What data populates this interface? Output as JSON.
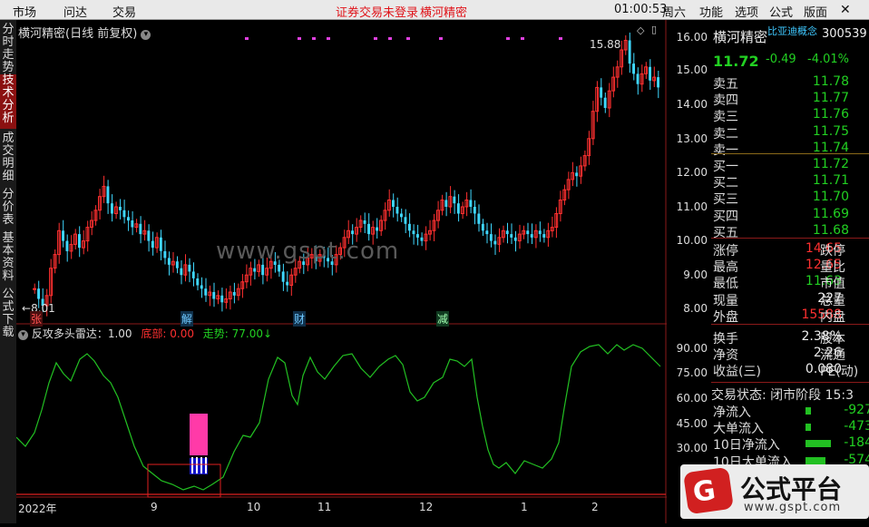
{
  "topbar": {
    "menu_left": [
      "市场",
      "问达",
      "交易"
    ],
    "notice": "证券交易未登录",
    "stock_name": "横河精密",
    "clock": "01:00:53",
    "weekday": "周六",
    "menu_right": [
      "功能",
      "选项",
      "公式",
      "版面"
    ]
  },
  "leftbar": [
    "分时走势",
    "技术分析",
    "成交明细",
    "分价表",
    "基本资料",
    "公式下载"
  ],
  "chart": {
    "title": "横河精密(日线 前复权)",
    "high_label": "15.88",
    "low_label": "8.01",
    "price_axis": [
      "16.00",
      "15.00",
      "14.00",
      "13.00",
      "12.00",
      "11.00",
      "10.00",
      "9.00",
      "8.00"
    ],
    "markers": [
      "张",
      "解",
      "财",
      "减"
    ],
    "indicator_name": "反攻多头雷达：1.00",
    "indicator_bottom": "底部: 0.00",
    "indicator_trend": "走势: 77.00",
    "indicator_axis": [
      "90.00",
      "75.00",
      "60.00",
      "45.00",
      "30.00"
    ],
    "x_axis": [
      "2022年",
      "9",
      "10",
      "11",
      "12",
      "1",
      "2"
    ],
    "watermark": "www.gspt.com",
    "logo_text": "公式平台",
    "logo_url": "www.gspt.com"
  },
  "quote": {
    "name": "横河精密",
    "code": "300539",
    "concept": "比亚迪概念",
    "price": "11.72",
    "change": "-0.49",
    "pct": "-4.01%",
    "asks": [
      {
        "l": "卖五",
        "v": "11.78"
      },
      {
        "l": "卖四",
        "v": "11.77"
      },
      {
        "l": "卖三",
        "v": "11.76"
      },
      {
        "l": "卖二",
        "v": "11.75"
      },
      {
        "l": "卖一",
        "v": "11.74"
      }
    ],
    "bids": [
      {
        "l": "买一",
        "v": "11.72"
      },
      {
        "l": "买二",
        "v": "11.71"
      },
      {
        "l": "买三",
        "v": "11.70"
      },
      {
        "l": "买四",
        "v": "11.69"
      },
      {
        "l": "买五",
        "v": "11.68"
      }
    ],
    "stats": [
      {
        "l": "涨停",
        "v": "14.65",
        "l2": "跌停",
        "c": "red"
      },
      {
        "l": "最高",
        "v": "12.65",
        "l2": "量比",
        "c": "red"
      },
      {
        "l": "最低",
        "v": "11.63",
        "l2": "市值",
        "c": "green"
      },
      {
        "l": "现量",
        "v": "227",
        "l2": "总量",
        "c": "white"
      },
      {
        "l": "外盘",
        "v": "15588",
        "l2": "内盘",
        "c": "red"
      }
    ],
    "stats2": [
      {
        "l": "换手",
        "v": "2.38%",
        "l2": "股本"
      },
      {
        "l": "净资",
        "v": "2.26",
        "l2": "流通"
      },
      {
        "l": "收益(三)",
        "v": "0.080",
        "l2": "PE(动)"
      }
    ],
    "trade_status": "交易状态: 闭市阶段 15:3",
    "flows": [
      {
        "l": "净流入",
        "v": "-927"
      },
      {
        "l": "大单流入",
        "v": "-473"
      },
      {
        "l": "10日净流入",
        "v": "-184"
      },
      {
        "l": "10日大单流入",
        "v": "-574"
      }
    ]
  }
}
